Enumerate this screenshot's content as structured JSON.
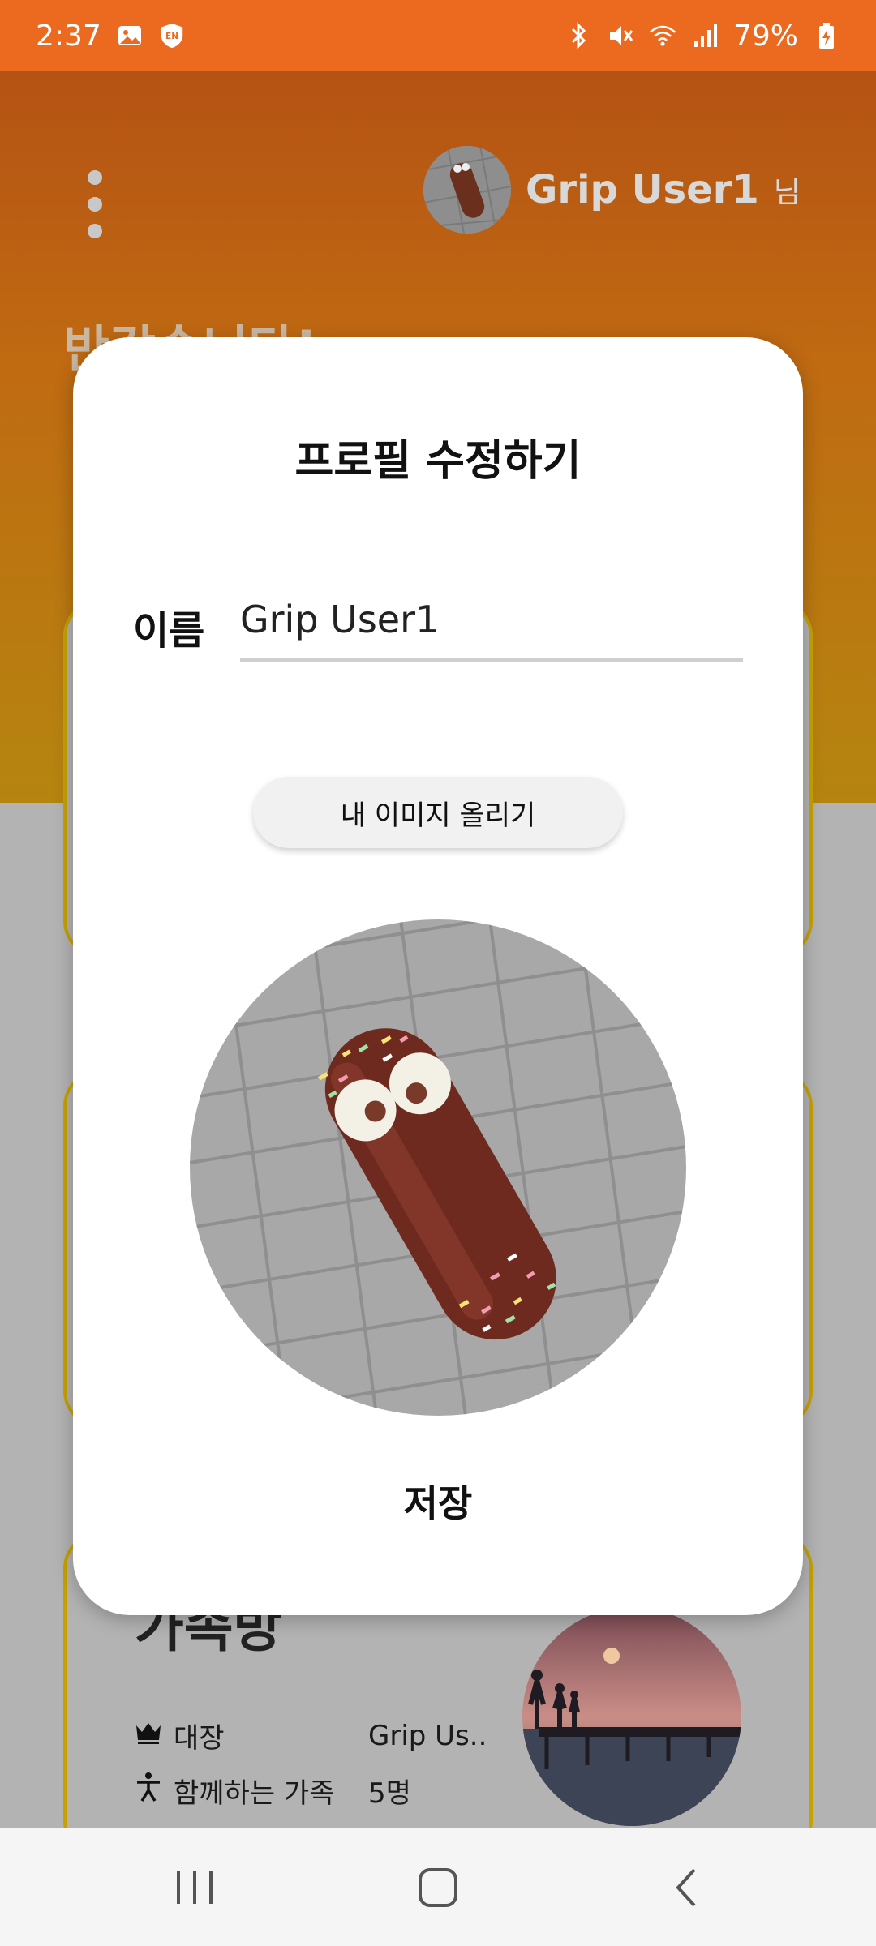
{
  "status_bar": {
    "time": "2:37",
    "battery": "79%",
    "icons": [
      "gallery-icon",
      "vpn-shield-icon",
      "bluetooth-icon",
      "mute-icon",
      "wifi-icon",
      "signal-icon",
      "battery-charging-icon"
    ]
  },
  "header": {
    "user_name": "Grip User1",
    "honorific": "님",
    "welcome_text": "반갑습니다!",
    "menu_icon": "more-vertical-icon"
  },
  "modal": {
    "title": "프로필 수정하기",
    "name_label": "이름",
    "name_value": "Grip User1",
    "upload_label": "내 이미지 올리기",
    "save_label": "저장"
  },
  "family_card": {
    "title": "가족방",
    "leader_label": "대장",
    "leader_value": "Grip Us..",
    "members_label": "함께하는 가족",
    "members_value": "5명"
  },
  "colors": {
    "accent": "#EC6A1F",
    "card_border": "#C7A100",
    "header_top": "#B24D14",
    "header_bottom": "#B58510"
  },
  "nav": {
    "icons": [
      "recent-apps-icon",
      "home-icon",
      "back-icon"
    ]
  }
}
